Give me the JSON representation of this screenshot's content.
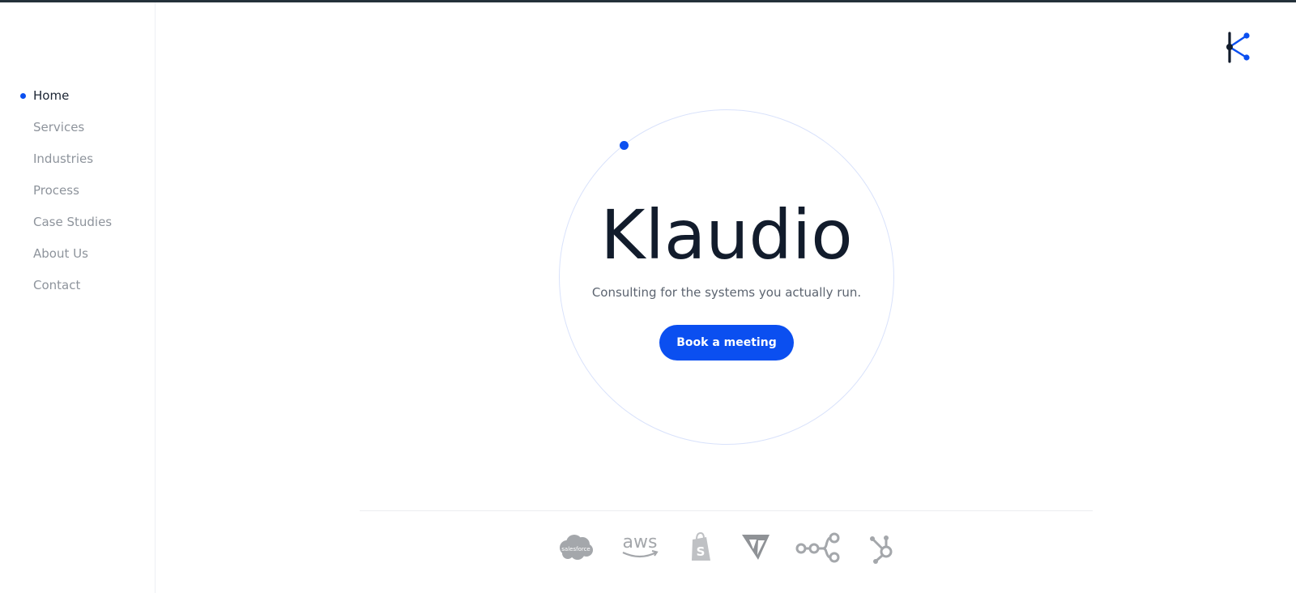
{
  "nav": {
    "items": [
      {
        "label": "Home",
        "active": true
      },
      {
        "label": "Services",
        "active": false
      },
      {
        "label": "Industries",
        "active": false
      },
      {
        "label": "Process",
        "active": false
      },
      {
        "label": "Case Studies",
        "active": false
      },
      {
        "label": "About Us",
        "active": false
      },
      {
        "label": "Contact",
        "active": false
      }
    ]
  },
  "hero": {
    "brand": "Klaudio",
    "tagline": "Consulting for the systems you actually run.",
    "cta_label": "Book a meeting"
  },
  "partners": {
    "salesforce_label": "salesforce",
    "aws_label": "aws",
    "icons": [
      "salesforce-icon",
      "aws-icon",
      "shopify-icon",
      "make-icon",
      "n8n-icon",
      "hubspot-icon"
    ]
  },
  "colors": {
    "accent": "#0b4ff0",
    "text_dark": "#121c2c",
    "text_muted": "#8e949c",
    "partner_gray": "#a4a7ab"
  }
}
